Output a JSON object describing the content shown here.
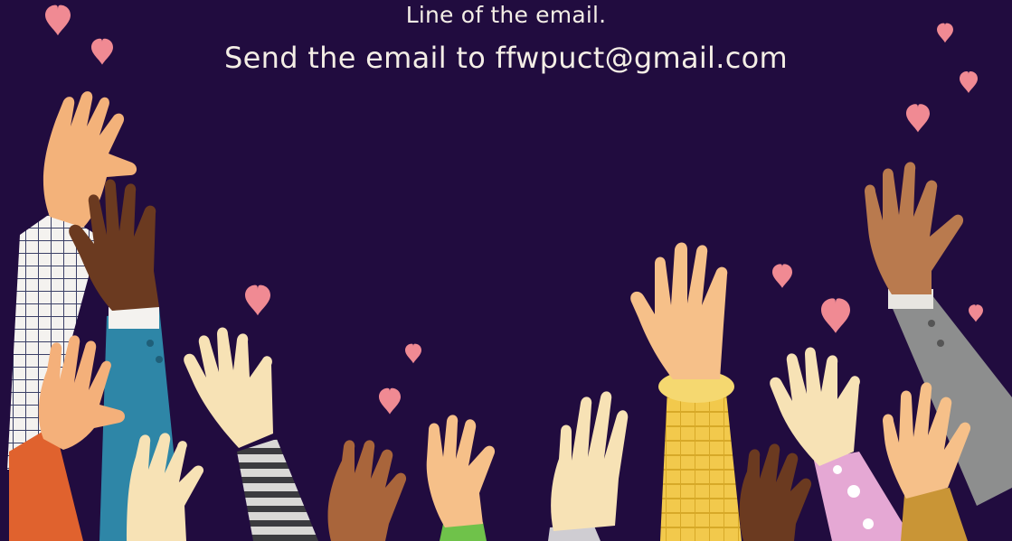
{
  "text": {
    "line1": "Line of the email.",
    "line2": "Send the email to ffwpuct@gmail.com"
  },
  "colors": {
    "background": "#210c3f",
    "text": "#f4eee6",
    "heart": "#f08a93"
  }
}
